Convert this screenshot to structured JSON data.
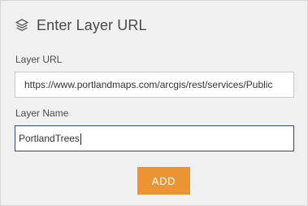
{
  "dialog": {
    "title": "Enter Layer URL",
    "header_icon": "layers-icon"
  },
  "layer_url": {
    "label": "Layer URL",
    "value": "https://www.portlandmaps.com/arcgis/rest/services/Public"
  },
  "layer_name": {
    "label": "Layer Name",
    "value": "PortlandTrees"
  },
  "actions": {
    "add_label": "ADD"
  },
  "colors": {
    "panel_background": "#f0f0f0",
    "accent_button": "#ec9433",
    "focused_border": "#2b4a6f"
  }
}
